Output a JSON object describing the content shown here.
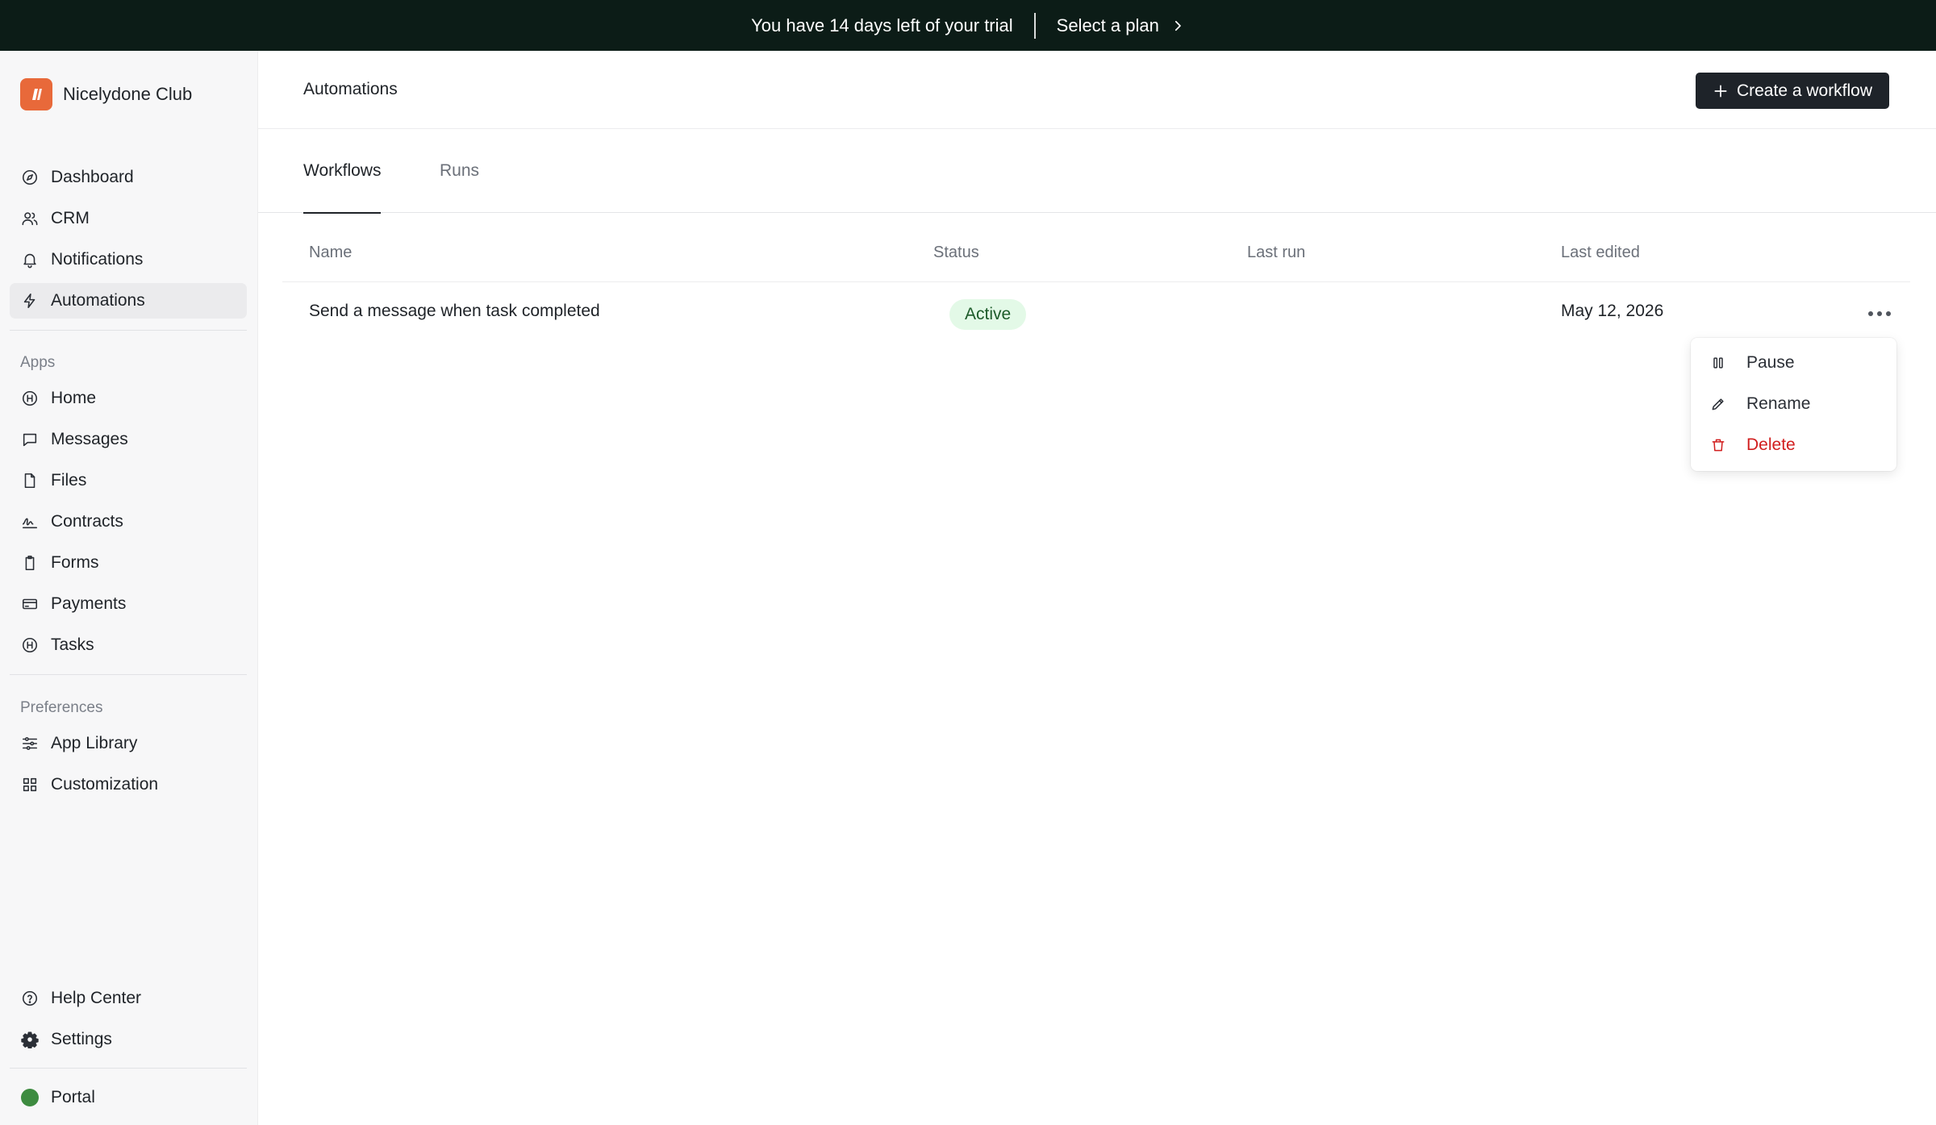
{
  "banner": {
    "trial_text": "You have 14 days left of your trial",
    "cta_label": "Select a plan"
  },
  "brand": {
    "name": "Nicelydone Club",
    "logo_color": "#e8693a"
  },
  "sidebar": {
    "main_items": [
      {
        "label": "Dashboard",
        "icon": "compass-icon"
      },
      {
        "label": "CRM",
        "icon": "users-icon"
      },
      {
        "label": "Notifications",
        "icon": "bell-icon"
      },
      {
        "label": "Automations",
        "icon": "bolt-icon",
        "active": true
      }
    ],
    "apps_label": "Apps",
    "app_items": [
      {
        "label": "Home",
        "icon": "home-icon"
      },
      {
        "label": "Messages",
        "icon": "message-icon"
      },
      {
        "label": "Files",
        "icon": "file-icon"
      },
      {
        "label": "Contracts",
        "icon": "signature-icon"
      },
      {
        "label": "Forms",
        "icon": "clipboard-icon"
      },
      {
        "label": "Payments",
        "icon": "credit-card-icon"
      },
      {
        "label": "Tasks",
        "icon": "tasks-icon"
      }
    ],
    "preferences_label": "Preferences",
    "preference_items": [
      {
        "label": "App Library",
        "icon": "sliders-icon"
      },
      {
        "label": "Customization",
        "icon": "grid-icon"
      }
    ],
    "footer_items": [
      {
        "label": "Help Center",
        "icon": "help-icon"
      },
      {
        "label": "Settings",
        "icon": "gear-icon"
      }
    ],
    "portal": {
      "label": "Portal",
      "status_color": "#3d8b40"
    }
  },
  "header": {
    "title": "Automations",
    "create_label": "Create a workflow"
  },
  "tabs": [
    {
      "label": "Workflows",
      "active": true
    },
    {
      "label": "Runs",
      "active": false
    }
  ],
  "table": {
    "columns": [
      "Name",
      "Status",
      "Last run",
      "Last edited"
    ],
    "rows": [
      {
        "name": "Send a message when task completed",
        "status": "Active",
        "last_run": "",
        "last_edited": "May 12, 2026"
      }
    ]
  },
  "row_menu": {
    "items": [
      {
        "label": "Pause",
        "icon": "pause-icon"
      },
      {
        "label": "Rename",
        "icon": "pencil-icon"
      },
      {
        "label": "Delete",
        "icon": "trash-icon",
        "danger": true
      }
    ]
  }
}
